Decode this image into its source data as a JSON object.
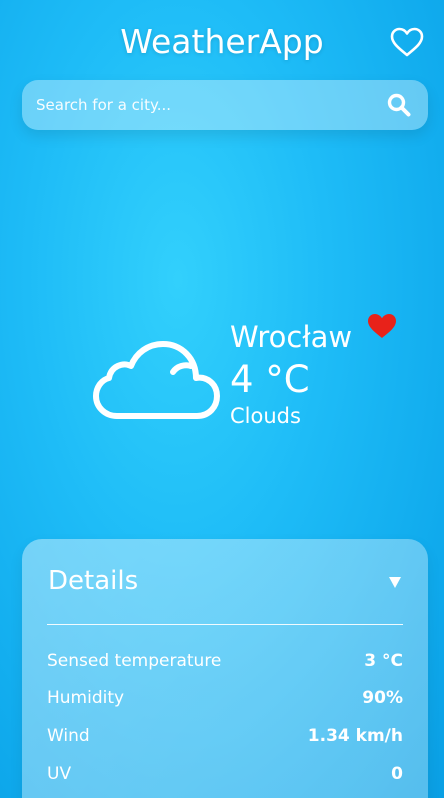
{
  "header": {
    "title": "WeatherApp",
    "favorites_icon": "heart-outline-icon"
  },
  "search": {
    "placeholder": "Search for a city...",
    "value": "",
    "icon": "search-icon"
  },
  "current": {
    "condition_icon": "cloud-icon",
    "city": "Wrocław",
    "favorite_icon": "heart-filled-icon",
    "favorite_color": "#e8221a",
    "temperature": "4 °C",
    "description": "Clouds"
  },
  "details": {
    "title": "Details",
    "toggle_icon": "triangle-down-icon",
    "rows": [
      {
        "label": "Sensed temperature",
        "value": "3 °C"
      },
      {
        "label": "Humidity",
        "value": "90%"
      },
      {
        "label": "Wind",
        "value": "1.34 km/h"
      },
      {
        "label": "UV",
        "value": "0"
      }
    ]
  },
  "colors": {
    "background": "#1ebcf7",
    "text": "#ffffff"
  }
}
